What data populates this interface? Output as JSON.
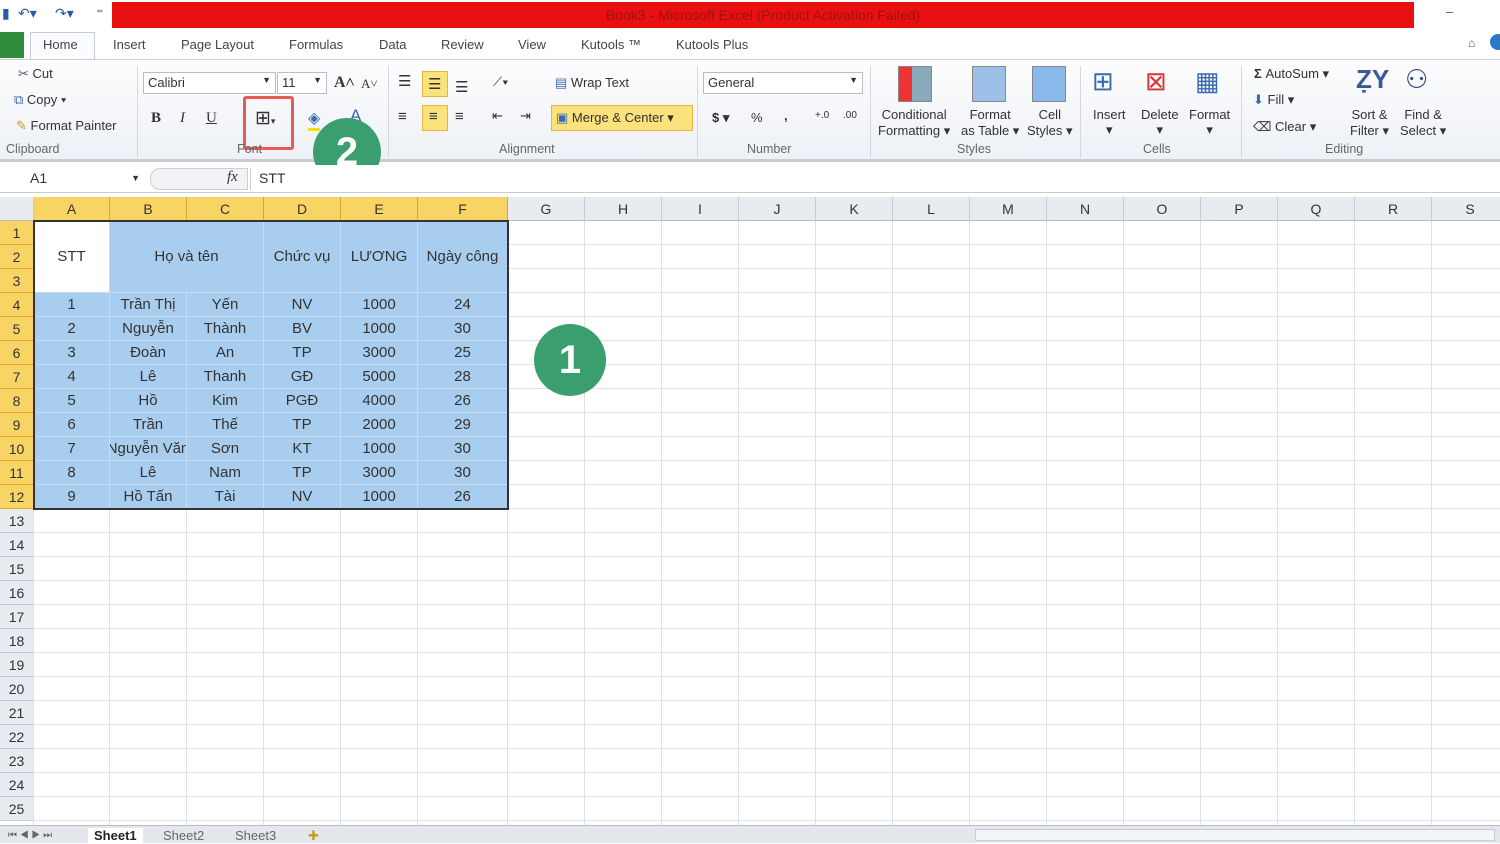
{
  "window": {
    "title": "Book3 - Microsoft Excel (Product Activation Failed)",
    "minimize": "–"
  },
  "ribbon_tabs": [
    "Home",
    "Insert",
    "Page Layout",
    "Formulas",
    "Data",
    "Review",
    "View",
    "Kutools ™",
    "Kutools Plus"
  ],
  "clipboard": {
    "cut": "Cut",
    "copy": "Copy",
    "format_painter": "Format Painter",
    "group": "Clipboard"
  },
  "font": {
    "name": "Calibri",
    "size": "11",
    "bold": "B",
    "italic": "I",
    "underline": "U",
    "group": "Font"
  },
  "alignment": {
    "wrap_text": "Wrap Text",
    "merge_center": "Merge & Center",
    "group": "Alignment"
  },
  "number": {
    "format": "General",
    "currency": "$",
    "percent": "%",
    "comma": ",",
    "group": "Number"
  },
  "styles": {
    "conditional": [
      "Conditional",
      "Formatting ▾"
    ],
    "format_table": [
      "Format",
      "as Table ▾"
    ],
    "cell_styles": [
      "Cell",
      "Styles ▾"
    ],
    "group": "Styles"
  },
  "cells": {
    "insert": "Insert",
    "delete": "Delete",
    "format": "Format",
    "group": "Cells"
  },
  "editing": {
    "autosum": "AutoSum ▾",
    "fill": "Fill ▾",
    "clear": "Clear ▾",
    "sort": [
      "Sort &",
      "Filter ▾"
    ],
    "find": [
      "Find &",
      "Select ▾"
    ],
    "group": "Editing"
  },
  "formula_bar": {
    "name_box": "A1",
    "fx": "fx",
    "value": "STT"
  },
  "annotations": {
    "step1": "1",
    "step2": "2",
    "accent": "#3a9e6e",
    "highlight_border": "#e85a5a"
  },
  "columns": [
    "A",
    "B",
    "C",
    "D",
    "E",
    "F",
    "G",
    "H",
    "I",
    "J",
    "K",
    "L",
    "M",
    "N",
    "O",
    "P",
    "Q",
    "R",
    "S"
  ],
  "rows": [
    "1",
    "2",
    "3",
    "4",
    "5",
    "6",
    "7",
    "8",
    "9",
    "10",
    "11",
    "12",
    "13",
    "14",
    "15",
    "16",
    "17",
    "18",
    "19",
    "20",
    "21",
    "22",
    "23",
    "24",
    "25"
  ],
  "table": {
    "headers": [
      "STT",
      "Họ và tên",
      "Chức vụ",
      "LƯƠNG",
      "Ngày công"
    ],
    "body": [
      [
        "1",
        "Trần Thị",
        "Yến",
        "NV",
        "1000",
        "24"
      ],
      [
        "2",
        "Nguyễn",
        "Thành",
        "BV",
        "1000",
        "30"
      ],
      [
        "3",
        "Đoàn",
        "An",
        "TP",
        "3000",
        "25"
      ],
      [
        "4",
        "Lê",
        "Thanh",
        "GĐ",
        "5000",
        "28"
      ],
      [
        "5",
        "Hồ",
        "Kim",
        "PGĐ",
        "4000",
        "26"
      ],
      [
        "6",
        "Trần",
        "Thế",
        "TP",
        "2000",
        "29"
      ],
      [
        "7",
        "Nguyễn Văn",
        "Sơn",
        "KT",
        "1000",
        "30"
      ],
      [
        "8",
        "Lê",
        "Nam",
        "TP",
        "3000",
        "30"
      ],
      [
        "9",
        "Hồ Tấn",
        "Tài",
        "NV",
        "1000",
        "26"
      ]
    ],
    "fill": "#a9cdee"
  },
  "sheets": [
    "Sheet1",
    "Sheet2",
    "Sheet3"
  ]
}
